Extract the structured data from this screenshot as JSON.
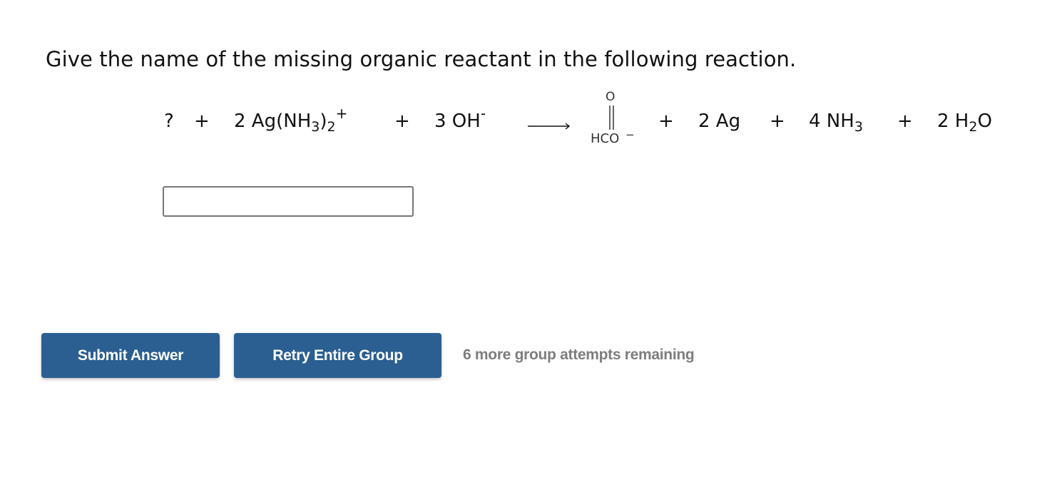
{
  "question": {
    "prompt": "Give the name of the missing organic reactant in the following reaction."
  },
  "reaction": {
    "unknown": "?",
    "plus": "+",
    "reactant2": {
      "coef": "2 Ag(NH",
      "sub1": "3",
      "close": ")",
      "sub2": "2",
      "charge": "+"
    },
    "reactant3": {
      "coef": "3 OH",
      "charge": "-"
    },
    "product1": {
      "top_atom": "O",
      "bottom": "HCO",
      "charge": "−"
    },
    "product2": "2 Ag",
    "product3": {
      "text": "4 NH",
      "sub": "3"
    },
    "product4": {
      "pre": "2 H",
      "sub": "2",
      "post": "O"
    }
  },
  "answer": {
    "value": "",
    "placeholder": ""
  },
  "actions": {
    "submit_label": "Submit Answer",
    "retry_label": "Retry Entire Group",
    "attempts_text": "6 more group attempts remaining"
  },
  "colors": {
    "button_bg": "#2b5f91",
    "attempts_text": "#7d7d7d"
  }
}
